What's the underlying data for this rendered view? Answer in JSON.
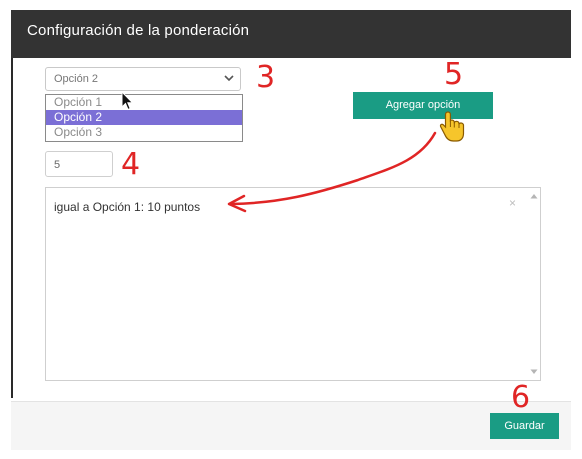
{
  "modal": {
    "title": "Configuración de la ponderación"
  },
  "select": {
    "value": "Opción 2",
    "options": [
      "Opción 1",
      "Opción 2",
      "Opción 3"
    ]
  },
  "points_input": {
    "value": "5"
  },
  "add_button": {
    "label": "Agregar opción"
  },
  "textarea": {
    "entry": "igual a Opción 1: 10 puntos",
    "clear_symbol": "×"
  },
  "footer": {
    "save_label": "Guardar"
  },
  "annotations": {
    "step3": "3",
    "step4": "4",
    "step5": "5",
    "step6": "6"
  },
  "colors": {
    "header": "#333333",
    "accent": "#1a9c84",
    "selection": "#7b6fd6",
    "annotation": "#e02525"
  }
}
